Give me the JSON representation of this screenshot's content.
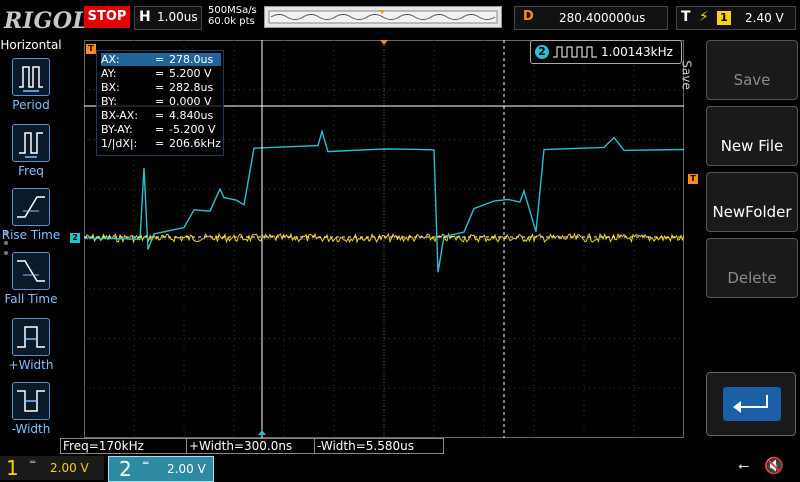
{
  "brand": "RIGOL",
  "run_state": "STOP",
  "horizontal": {
    "key": "H",
    "timebase": "1.00us"
  },
  "sampling": {
    "rate": "500MSa/s",
    "points": "60.0k pts"
  },
  "delay": {
    "key": "D",
    "value": "280.400000us"
  },
  "trigger": {
    "key": "T",
    "edge_icon": "rising-edge",
    "source": "1",
    "level": "2.40 V"
  },
  "left_menu": {
    "title": "Horizontal",
    "items": [
      {
        "label": "Period",
        "icon": "period-icon"
      },
      {
        "label": "Freq",
        "icon": "freq-icon"
      },
      {
        "label": "Rise Time",
        "icon": "rise-time-icon"
      },
      {
        "label": "Fall Time",
        "icon": "fall-time-icon"
      },
      {
        "label": "+Width",
        "icon": "pos-width-icon"
      },
      {
        "label": "-Width",
        "icon": "neg-width-icon"
      }
    ]
  },
  "right_menu": {
    "tab": "Save",
    "buttons": [
      {
        "label": "Save",
        "enabled": false
      },
      {
        "label": "New File",
        "enabled": true
      },
      {
        "label": "NewFolder",
        "enabled": true
      },
      {
        "label": "Delete",
        "enabled": false
      }
    ]
  },
  "cursor_measure": {
    "rows": [
      {
        "k": "AX:",
        "v": "278.0us"
      },
      {
        "k": "AY:",
        "v": "5.200 V"
      },
      {
        "k": "BX:",
        "v": "282.8us"
      },
      {
        "k": "BY:",
        "v": "0.000 V"
      },
      {
        "k": "BX-AX:",
        "v": "4.840us"
      },
      {
        "k": "BY-AY:",
        "v": "-5.200 V"
      },
      {
        "k": "1/|dX|:",
        "v": "206.6kHz"
      }
    ]
  },
  "freq_counter": {
    "channel": "2",
    "value": "1.00143kHz"
  },
  "bottom_measurements": [
    "Freq=170kHz",
    "+Width=300.0ns",
    "-Width=5.580us"
  ],
  "channels": [
    {
      "num": "1",
      "coupling": "DC",
      "scale": "2.00 V",
      "color": "#f5d20a"
    },
    {
      "num": "2",
      "coupling": "DC",
      "scale": "2.00 V",
      "color": "#28c0d0"
    }
  ],
  "colors": {
    "ch1": "#f5d20a",
    "ch2": "#28c0d0",
    "stop": "#e00000",
    "accent": "#ff8c1a"
  }
}
